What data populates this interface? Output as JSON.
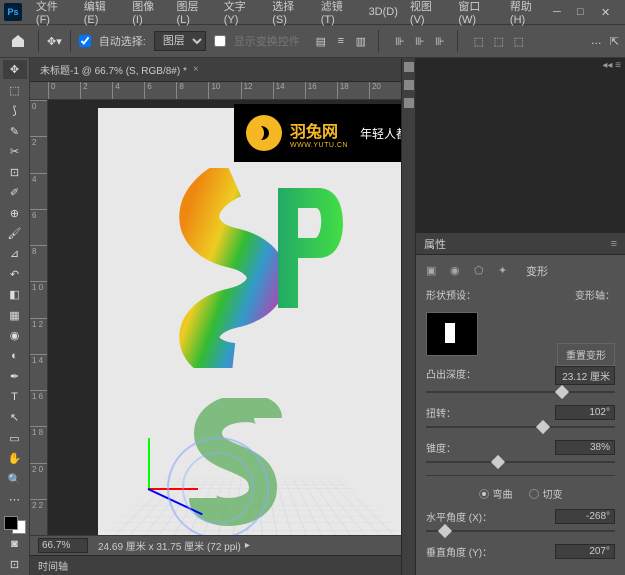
{
  "menubar": {
    "items": [
      "文件(F)",
      "编辑(E)",
      "图像(I)",
      "图层(L)",
      "文字(Y)",
      "选择(S)",
      "滤镜(T)",
      "3D(D)",
      "视图(V)",
      "窗口(W)",
      "帮助(H)"
    ]
  },
  "optbar": {
    "auto_select_label": "自动选择:",
    "target_select": "图层",
    "show_transform_label": "显示变换控件"
  },
  "document": {
    "tab_title": "未标题-1 @ 66.7% (S, RGB/8#) *",
    "zoom": "66.7%",
    "dimensions": "24.69 厘米 x 31.75 厘米 (72 ppi)",
    "timeline_label": "时间轴"
  },
  "ruler_h": [
    "",
    "0",
    "2",
    "4",
    "6",
    "8",
    "10",
    "12",
    "14",
    "16",
    "18",
    "20"
  ],
  "ruler_v": [
    "0",
    "2",
    "4",
    "6",
    "8",
    "1 0",
    "1 2",
    "1 4",
    "1 6",
    "1 8",
    "2 0",
    "2 2"
  ],
  "banner": {
    "brand": "羽兔网",
    "url": "WWW.YUTU.CN",
    "slogan": "年轻人都在用的自学设计平台"
  },
  "panel": {
    "title": "属性",
    "transform_label": "变形",
    "shape_preset_label": "形状预设：",
    "deform_axis_label": "变形轴：",
    "reset_button": "重置变形",
    "extrude_label": "凸出深度：",
    "extrude_value": "23.12 厘米",
    "extrude_pos": "72%",
    "twist_label": "扭转：",
    "twist_value": "102°",
    "twist_pos": "62%",
    "taper_label": "锥度：",
    "taper_value": "38%",
    "taper_pos": "38%",
    "bend_label": "弯曲",
    "shear_label": "切变",
    "h_angle_label": "水平角度 (X)：",
    "h_angle_value": "-268°",
    "h_angle_pos": "10%",
    "v_angle_label": "垂直角度 (Y)：",
    "v_angle_value": "207°"
  }
}
